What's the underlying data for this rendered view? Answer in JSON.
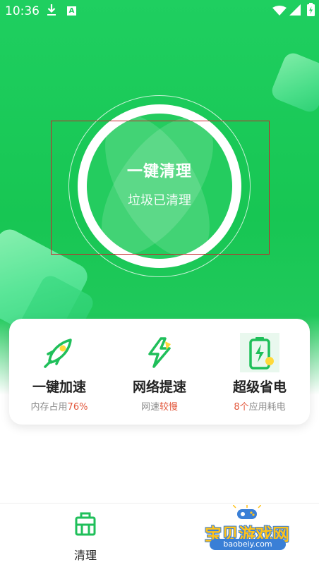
{
  "status_bar": {
    "time": "10:36",
    "icons": [
      "download-icon",
      "a-notification-icon",
      "wifi-icon",
      "signal-icon",
      "battery-charging-icon"
    ]
  },
  "main": {
    "clean_button_title": "一键清理",
    "clean_status": "垃圾已清理"
  },
  "features": [
    {
      "name": "一键加速",
      "desc_prefix": "内存占用",
      "desc_highlight": "76%",
      "desc_suffix": "",
      "icon": "rocket-icon"
    },
    {
      "name": "网络提速",
      "desc_prefix": "网速",
      "desc_highlight": "较慢",
      "desc_suffix": "",
      "icon": "lightning-icon"
    },
    {
      "name": "超级省电",
      "desc_prefix": "",
      "desc_highlight": "8个",
      "desc_suffix": "应用耗电",
      "icon": "battery-icon"
    }
  ],
  "bottom_nav": {
    "items": [
      {
        "label": "清理",
        "icon": "cleaner-bucket-icon"
      }
    ]
  },
  "watermark": {
    "title": "宝贝游戏网",
    "url": "baobeiy.com"
  },
  "colors": {
    "brand_green": "#1fcf60",
    "highlight_orange": "#e2563a",
    "annotation_red": "#c8242c"
  }
}
